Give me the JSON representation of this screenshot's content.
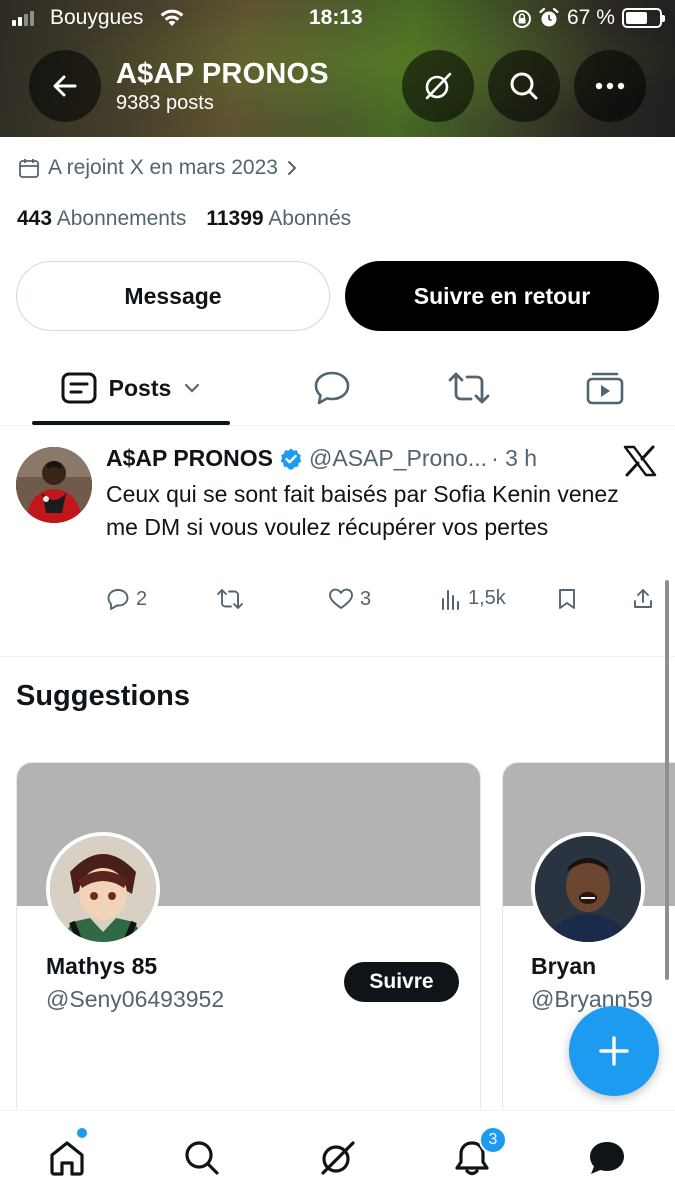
{
  "status_bar": {
    "carrier": "Bouygues",
    "time": "18:13",
    "battery_percent": "67 %",
    "battery_level": 0.67
  },
  "header": {
    "title": "A$AP PRONOS",
    "posts_count": "9383 posts",
    "icons": [
      "back-arrow-icon",
      "grok-icon",
      "search-icon",
      "more-icon"
    ]
  },
  "profile": {
    "joined": "A rejoint X en mars 2023",
    "following_count": "443",
    "following_label": "Abonnements",
    "followers_count": "11399",
    "followers_label": "Abonnés",
    "message_button": "Message",
    "follow_back_button": "Suivre en retour"
  },
  "tabs": {
    "posts_label": "Posts",
    "icons": [
      "posts-icon",
      "replies-icon",
      "reposts-icon",
      "media-icon"
    ]
  },
  "post": {
    "author_name": "A$AP PRONOS",
    "author_handle": "@ASAP_Prono...",
    "time": "· 3 h",
    "text": "Ceux qui se sont fait baisés par Sofia Kenin venez me DM si vous voulez récupérer vos pertes",
    "replies": "2",
    "reposts": "",
    "likes": "3",
    "views": "1,5k"
  },
  "suggestions": {
    "title": "Suggestions",
    "cards": [
      {
        "name": "Mathys 85",
        "handle": "@Seny06493952",
        "follow_button": "Suivre"
      },
      {
        "name": "Bryan",
        "handle": "@Bryann59"
      }
    ]
  },
  "bottom_nav": {
    "items": [
      "home-icon",
      "search-icon",
      "grok-icon",
      "notifications-icon",
      "messages-icon"
    ],
    "notifications_badge": "3"
  },
  "colors": {
    "accent": "#1d9bf0",
    "text_primary": "#0f1419",
    "text_secondary": "#536471",
    "banner_grey": "#b3b3b3"
  }
}
